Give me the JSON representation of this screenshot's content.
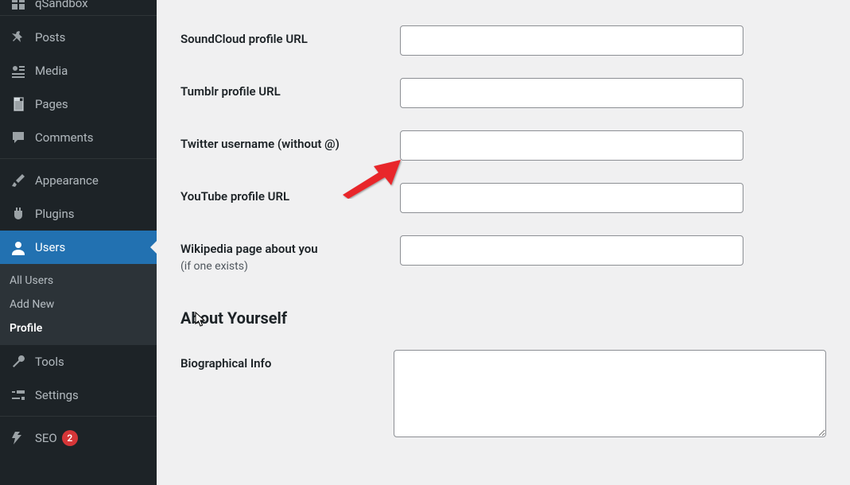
{
  "sidebar": {
    "top_cut_label": "qSandbox",
    "items": [
      {
        "label": "Posts",
        "icon": "pin"
      },
      {
        "label": "Media",
        "icon": "media"
      },
      {
        "label": "Pages",
        "icon": "pages"
      },
      {
        "label": "Comments",
        "icon": "comment"
      }
    ],
    "items2": [
      {
        "label": "Appearance",
        "icon": "brush"
      },
      {
        "label": "Plugins",
        "icon": "plug"
      },
      {
        "label": "Users",
        "icon": "user",
        "active": true
      }
    ],
    "submenu": [
      {
        "label": "All Users"
      },
      {
        "label": "Add New"
      },
      {
        "label": "Profile",
        "current": true
      }
    ],
    "items3": [
      {
        "label": "Tools",
        "icon": "wrench"
      },
      {
        "label": "Settings",
        "icon": "sliders"
      }
    ],
    "items4": [
      {
        "label": "SEO",
        "icon": "seo",
        "badge": "2"
      }
    ]
  },
  "form": {
    "fields": [
      {
        "label": "SoundCloud profile URL",
        "value": ""
      },
      {
        "label": "Tumblr profile URL",
        "value": ""
      },
      {
        "label": "Twitter username (without @)",
        "value": ""
      },
      {
        "label": "YouTube profile URL",
        "value": ""
      },
      {
        "label": "Wikipedia page about you",
        "sublabel": "(if one exists)",
        "value": ""
      }
    ],
    "section_title": "About Yourself",
    "bio_label": "Biographical Info",
    "bio_value": ""
  }
}
